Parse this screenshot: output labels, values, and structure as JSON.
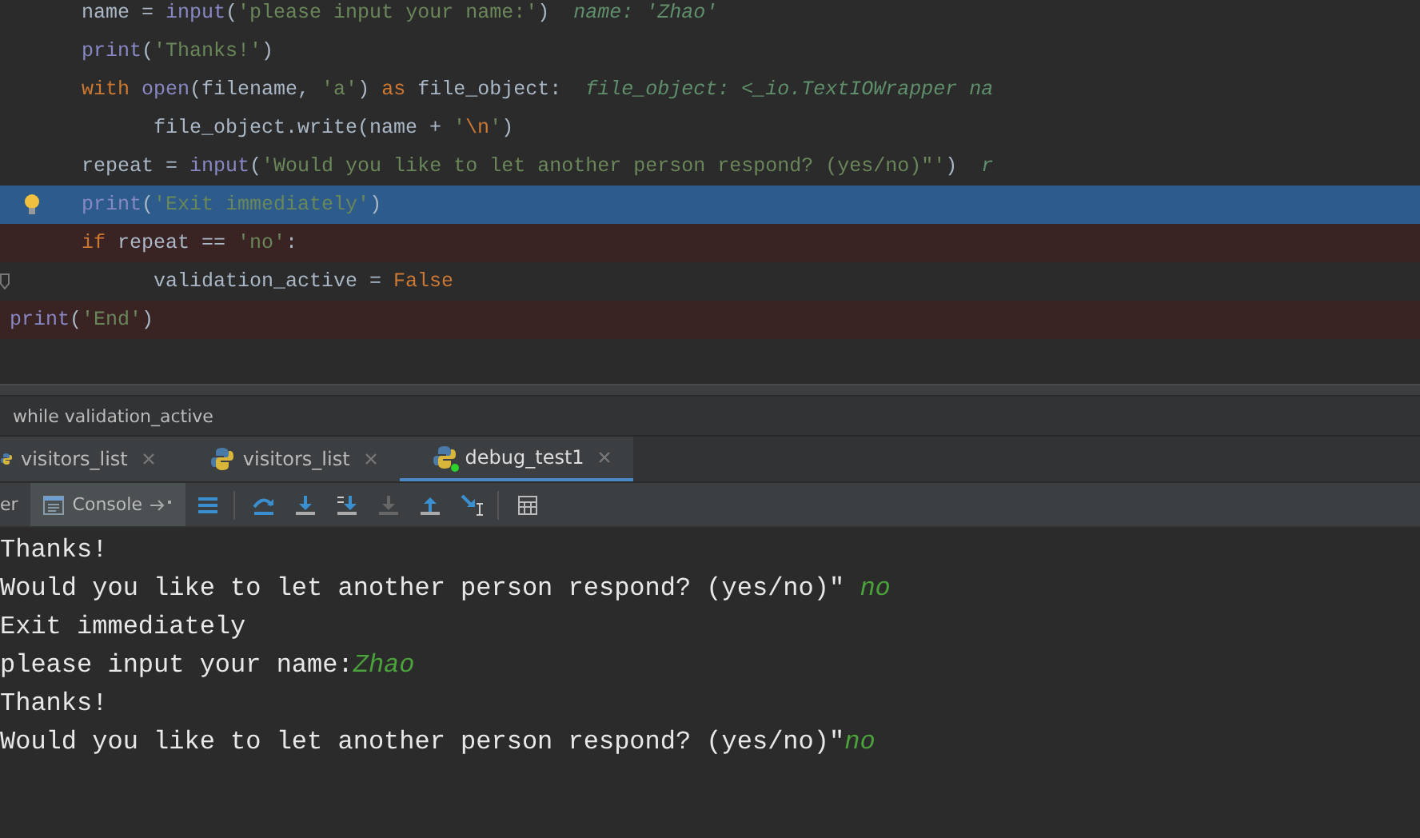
{
  "editor": {
    "lines": [
      {
        "kind": "block",
        "tokens": [
          {
            "t": "name = ",
            "kind": "plain"
          },
          {
            "t": "input",
            "kind": "call"
          },
          {
            "t": "(",
            "kind": "plain"
          },
          {
            "t": "'please input your name:'",
            "kind": "str"
          },
          {
            "t": ")",
            "kind": "plain"
          }
        ],
        "hint": "name: 'Zhao'",
        "current": false,
        "breakpoint": false,
        "bulb": false
      },
      {
        "kind": "block",
        "tokens": [
          {
            "t": "print",
            "kind": "call"
          },
          {
            "t": "(",
            "kind": "plain"
          },
          {
            "t": "'Thanks!'",
            "kind": "str"
          },
          {
            "t": ")",
            "kind": "plain"
          }
        ],
        "current": false,
        "breakpoint": false,
        "bulb": false
      },
      {
        "kind": "block",
        "tokens": [
          {
            "t": "with ",
            "kind": "kw"
          },
          {
            "t": "open",
            "kind": "call"
          },
          {
            "t": "(filename, ",
            "kind": "plain"
          },
          {
            "t": "'a'",
            "kind": "str"
          },
          {
            "t": ") ",
            "kind": "plain"
          },
          {
            "t": "as ",
            "kind": "kw"
          },
          {
            "t": "file_object:",
            "kind": "plain"
          }
        ],
        "hint": "file_object: <_io.TextIOWrapper na",
        "current": false,
        "breakpoint": false,
        "bulb": false
      },
      {
        "kind": "inner",
        "tokens": [
          {
            "t": "file_object.write(name + ",
            "kind": "plain"
          },
          {
            "t": "'",
            "kind": "str"
          },
          {
            "t": "\\n",
            "kind": "kw"
          },
          {
            "t": "'",
            "kind": "str"
          },
          {
            "t": ")",
            "kind": "plain"
          }
        ],
        "current": false,
        "breakpoint": false,
        "bulb": false
      },
      {
        "kind": "block",
        "tokens": [
          {
            "t": "repeat = ",
            "kind": "plain"
          },
          {
            "t": "input",
            "kind": "call"
          },
          {
            "t": "(",
            "kind": "plain"
          },
          {
            "t": "'Would you like to let another person respond? (yes/no)\"'",
            "kind": "str"
          },
          {
            "t": ")",
            "kind": "plain"
          }
        ],
        "hint": "r",
        "current": false,
        "breakpoint": false,
        "bulb": false
      },
      {
        "kind": "block",
        "tokens": [
          {
            "t": "print",
            "kind": "call"
          },
          {
            "t": "(",
            "kind": "plain"
          },
          {
            "t": "'Exit immediately'",
            "kind": "str"
          },
          {
            "t": ")",
            "kind": "plain"
          }
        ],
        "current": true,
        "breakpoint": false,
        "bulb": true
      },
      {
        "kind": "block",
        "tokens": [
          {
            "t": "if ",
            "kind": "kw"
          },
          {
            "t": "repeat == ",
            "kind": "plain"
          },
          {
            "t": "'no'",
            "kind": "str"
          },
          {
            "t": ":",
            "kind": "plain"
          }
        ],
        "current": false,
        "breakpoint": true,
        "bulb": false
      },
      {
        "kind": "inner",
        "tokens": [
          {
            "t": "validation_active = ",
            "kind": "plain"
          },
          {
            "t": "False",
            "kind": "kw"
          }
        ],
        "current": false,
        "breakpoint": false,
        "bulb": false
      },
      {
        "kind": "outer",
        "tokens": [
          {
            "t": "print",
            "kind": "call"
          },
          {
            "t": "(",
            "kind": "plain"
          },
          {
            "t": "'End'",
            "kind": "str"
          },
          {
            "t": ")",
            "kind": "plain"
          }
        ],
        "current": false,
        "breakpoint": true,
        "bulb": false
      }
    ]
  },
  "breadcrumb": "while validation_active",
  "tabs": [
    {
      "label": "visitors_list",
      "selected": false,
      "running": false
    },
    {
      "label": "visitors_list",
      "selected": false,
      "running": false
    },
    {
      "label": "debug_test1",
      "selected": true,
      "running": true
    }
  ],
  "tool_tabs": [
    {
      "label": "er",
      "selected": false
    },
    {
      "label": "Console",
      "selected": true
    }
  ],
  "console": [
    [
      {
        "t": "Thanks!",
        "kind": "out"
      }
    ],
    [
      {
        "t": "Would you like to let another person respond? (yes/no)\" ",
        "kind": "out"
      },
      {
        "t": "no",
        "kind": "input"
      }
    ],
    [
      {
        "t": "Exit immediately",
        "kind": "out"
      }
    ],
    [
      {
        "t": "please input your name:",
        "kind": "out"
      },
      {
        "t": "Zhao",
        "kind": "input"
      }
    ],
    [
      {
        "t": "Thanks!",
        "kind": "out"
      }
    ],
    [
      {
        "t": "Would you like to let another person respond? (yes/no)\"",
        "kind": "out"
      },
      {
        "t": "no",
        "kind": "input"
      }
    ]
  ]
}
